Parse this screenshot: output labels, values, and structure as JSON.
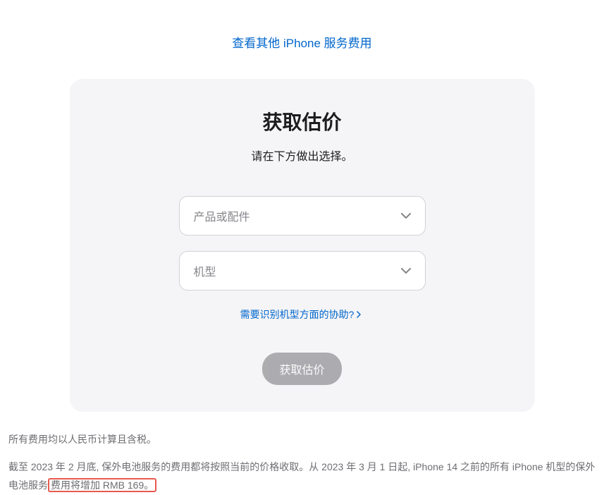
{
  "topLink": {
    "text": "查看其他 iPhone 服务费用"
  },
  "card": {
    "title": "获取估价",
    "subtitle": "请在下方做出选择。",
    "select1": {
      "placeholder": "产品或配件"
    },
    "select2": {
      "placeholder": "机型"
    },
    "helpLink": "需要识别机型方面的协助?",
    "submitLabel": "获取估价"
  },
  "footer": {
    "line1": "所有费用均以人民币计算且含税。",
    "line2_prefix": "截至 2023 年 2 月底, 保外电池服务的费用都将按照当前的价格收取。从 2023 年 3 月 1 日起, iPhone 14 之前的所有 iPhone 机型的保外电池服务",
    "line2_highlighted": "费用将增加 RMB 169。"
  }
}
